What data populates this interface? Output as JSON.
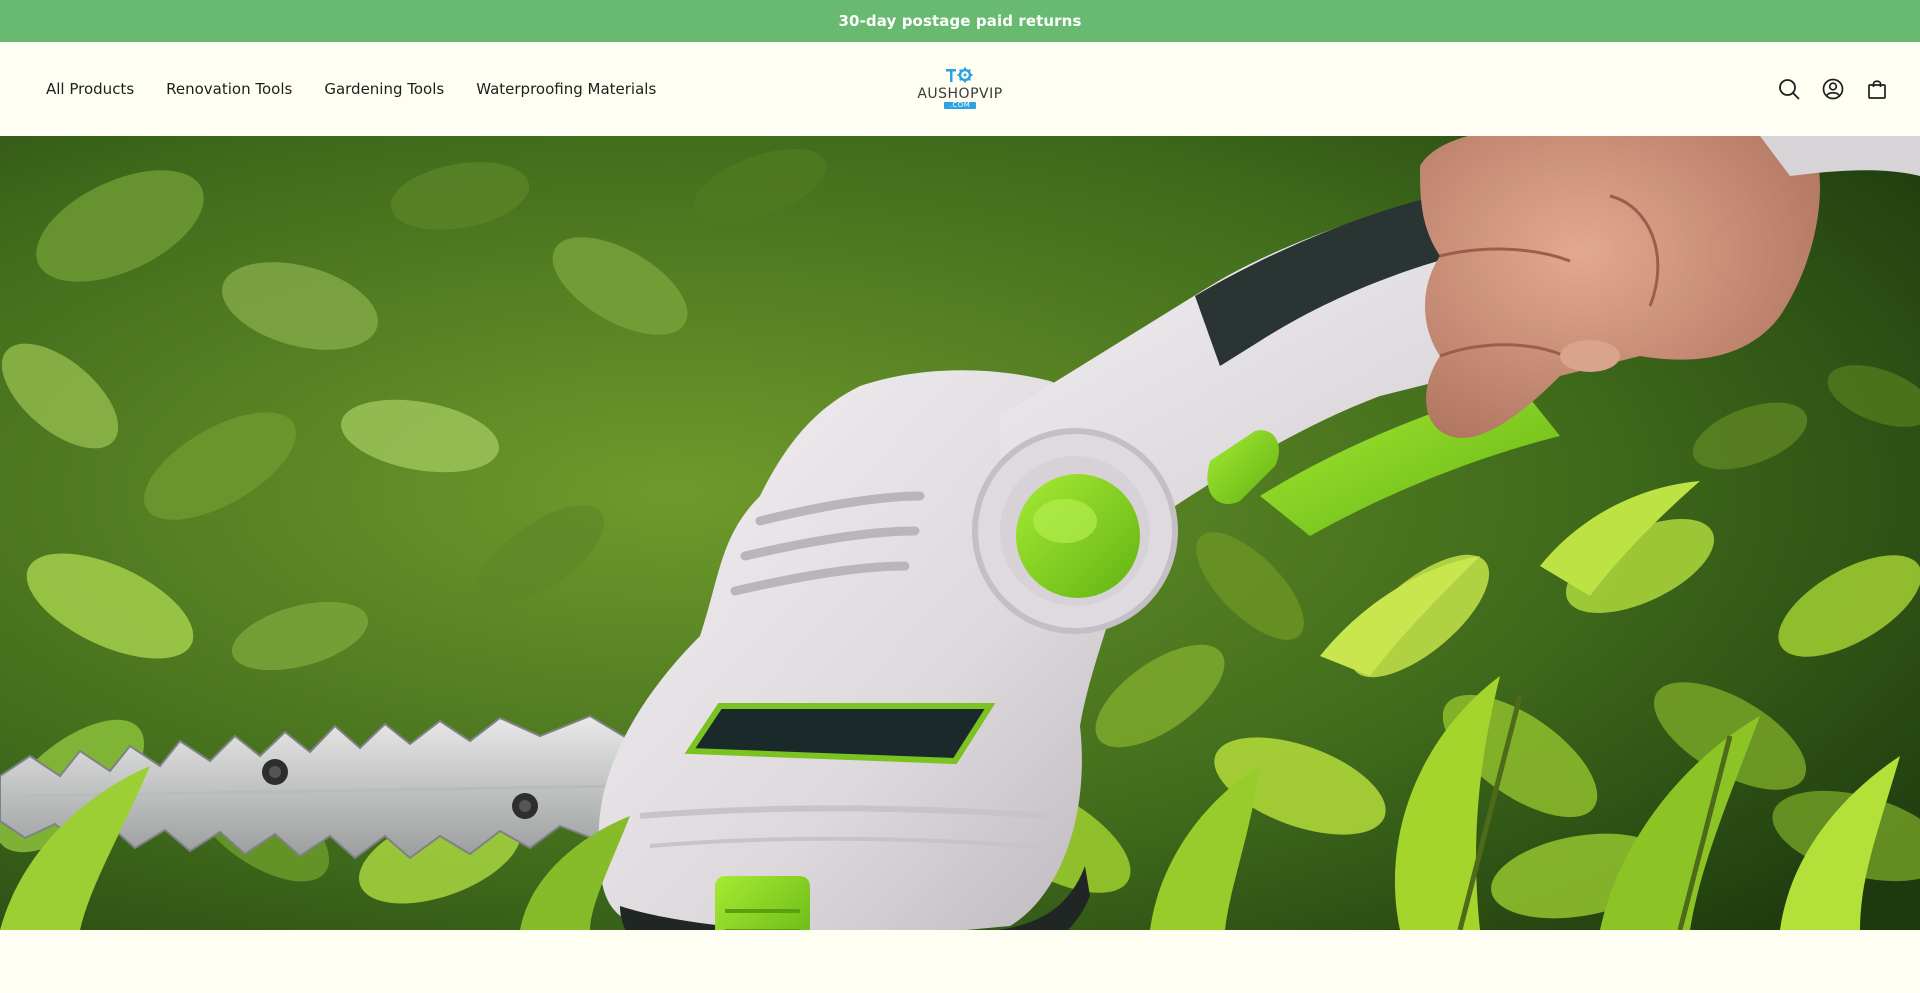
{
  "announcement": {
    "text": "30-day postage paid returns",
    "background": "#68ba70"
  },
  "header": {
    "nav": [
      {
        "label": "All Products"
      },
      {
        "label": "Renovation Tools"
      },
      {
        "label": "Gardening Tools"
      },
      {
        "label": "Waterproofing Materials"
      }
    ],
    "logo": {
      "name": "AUSHOPVIP",
      "sub": ".COM"
    },
    "icons": [
      "search-icon",
      "account-icon",
      "cart-icon"
    ]
  },
  "hero": {
    "image": "cordless hedge trimmer cutting green shrubs",
    "colors": {
      "accent": "#8fd624",
      "body": "#e6e3e6",
      "foliage": "#4f7a22"
    }
  }
}
